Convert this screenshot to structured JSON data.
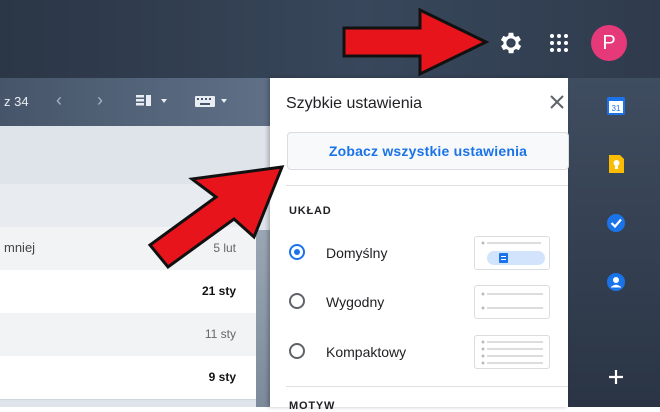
{
  "header": {
    "avatar_letter": "P",
    "icons": [
      "gear-icon",
      "apps-grid-icon"
    ]
  },
  "toolbar": {
    "count": "z 34",
    "icons": [
      "chevron-left-icon",
      "chevron-right-icon",
      "split-pane-icon",
      "keyboard-icon"
    ]
  },
  "maillist": {
    "rows": [
      {
        "snippet": "",
        "date": ""
      },
      {
        "snippet": "mniej",
        "date": "5 lut",
        "bold": false
      },
      {
        "snippet": "",
        "date": "21 sty",
        "bold": true
      },
      {
        "snippet": "",
        "date": "11 sty",
        "bold": false
      },
      {
        "snippet": "",
        "date": "9 sty",
        "bold": true
      }
    ]
  },
  "panel": {
    "title": "Szybkie ustawienia",
    "all_settings_label": "Zobacz wszystkie ustawienia",
    "section_label": "UKŁAD",
    "options": [
      {
        "label": "Domyślny",
        "selected": true
      },
      {
        "label": "Wygodny",
        "selected": false
      },
      {
        "label": "Kompaktowy",
        "selected": false
      }
    ],
    "next_section_label": "MOTYW"
  },
  "side_apps": [
    "calendar-icon",
    "keep-icon",
    "tasks-icon",
    "contacts-icon",
    "plus-icon"
  ],
  "colors": {
    "accent": "#1a73e8",
    "avatar": "#e5397a",
    "arrow": "#e8141c"
  }
}
